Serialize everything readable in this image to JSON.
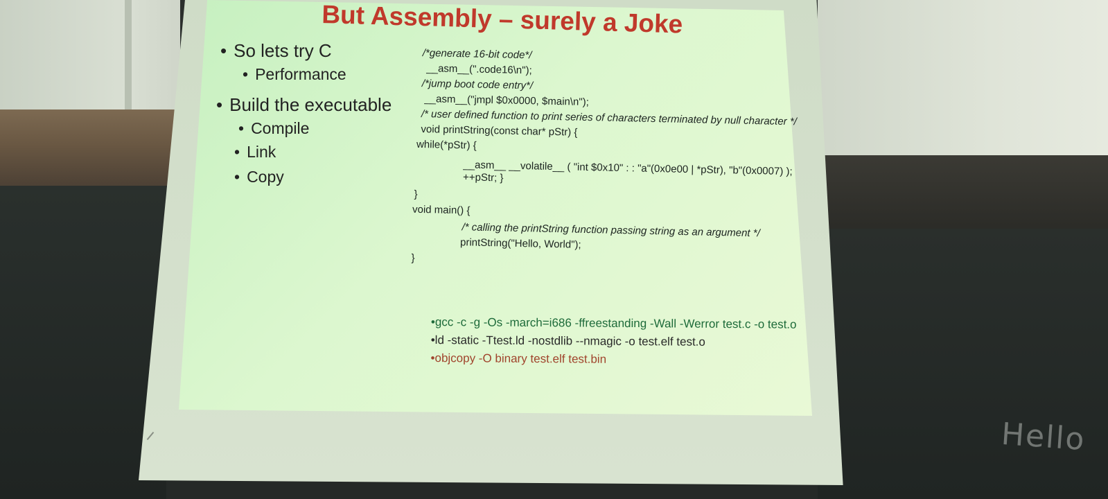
{
  "slide": {
    "title": "But Assembly – surely a Joke",
    "bullets": [
      {
        "level": 1,
        "text": "So lets try C"
      },
      {
        "level": 2,
        "text": "Performance"
      },
      {
        "level": 1,
        "text": "Build the executable"
      },
      {
        "level": 2,
        "text": "Compile"
      },
      {
        "level": 2,
        "text": "Link"
      },
      {
        "level": 2,
        "text": "Copy"
      }
    ],
    "code": [
      "/*generate 16-bit code*/",
      "__asm__(\".code16\\n\");",
      "/*jump boot code entry*/",
      "__asm__(\"jmpl $0x0000, $main\\n\");",
      "/* user defined function to print series of characters terminated by null character */",
      "void printString(const char* pStr) {",
      "while(*pStr) {",
      "__asm__ __volatile__ ( \"int $0x10\" : : \"a\"(0x0e00 | *pStr), \"b\"(0x0007) );",
      "++pStr; }",
      "}",
      "void main() {",
      "/* calling the printString function passing string as an argument */",
      "printString(\"Hello, World\");",
      "}"
    ],
    "commands": [
      "•gcc -c -g -Os -march=i686 -ffreestanding -Wall -Werror test.c -o test.o",
      "•ld -static -Ttest.ld -nostdlib --nmagic -o test.elf test.o",
      "•objcopy -O binary test.elf test.bin"
    ],
    "bullet_glyph": "•"
  },
  "chalkboard": {
    "scribble": "Hello"
  },
  "colors": {
    "title": "#c0392b",
    "slide_bg": "#d4f4c8",
    "cmd_gcc": "#1e6b3a",
    "cmd_ld": "#2a2a2a",
    "cmd_objcopy": "#a0442c"
  }
}
